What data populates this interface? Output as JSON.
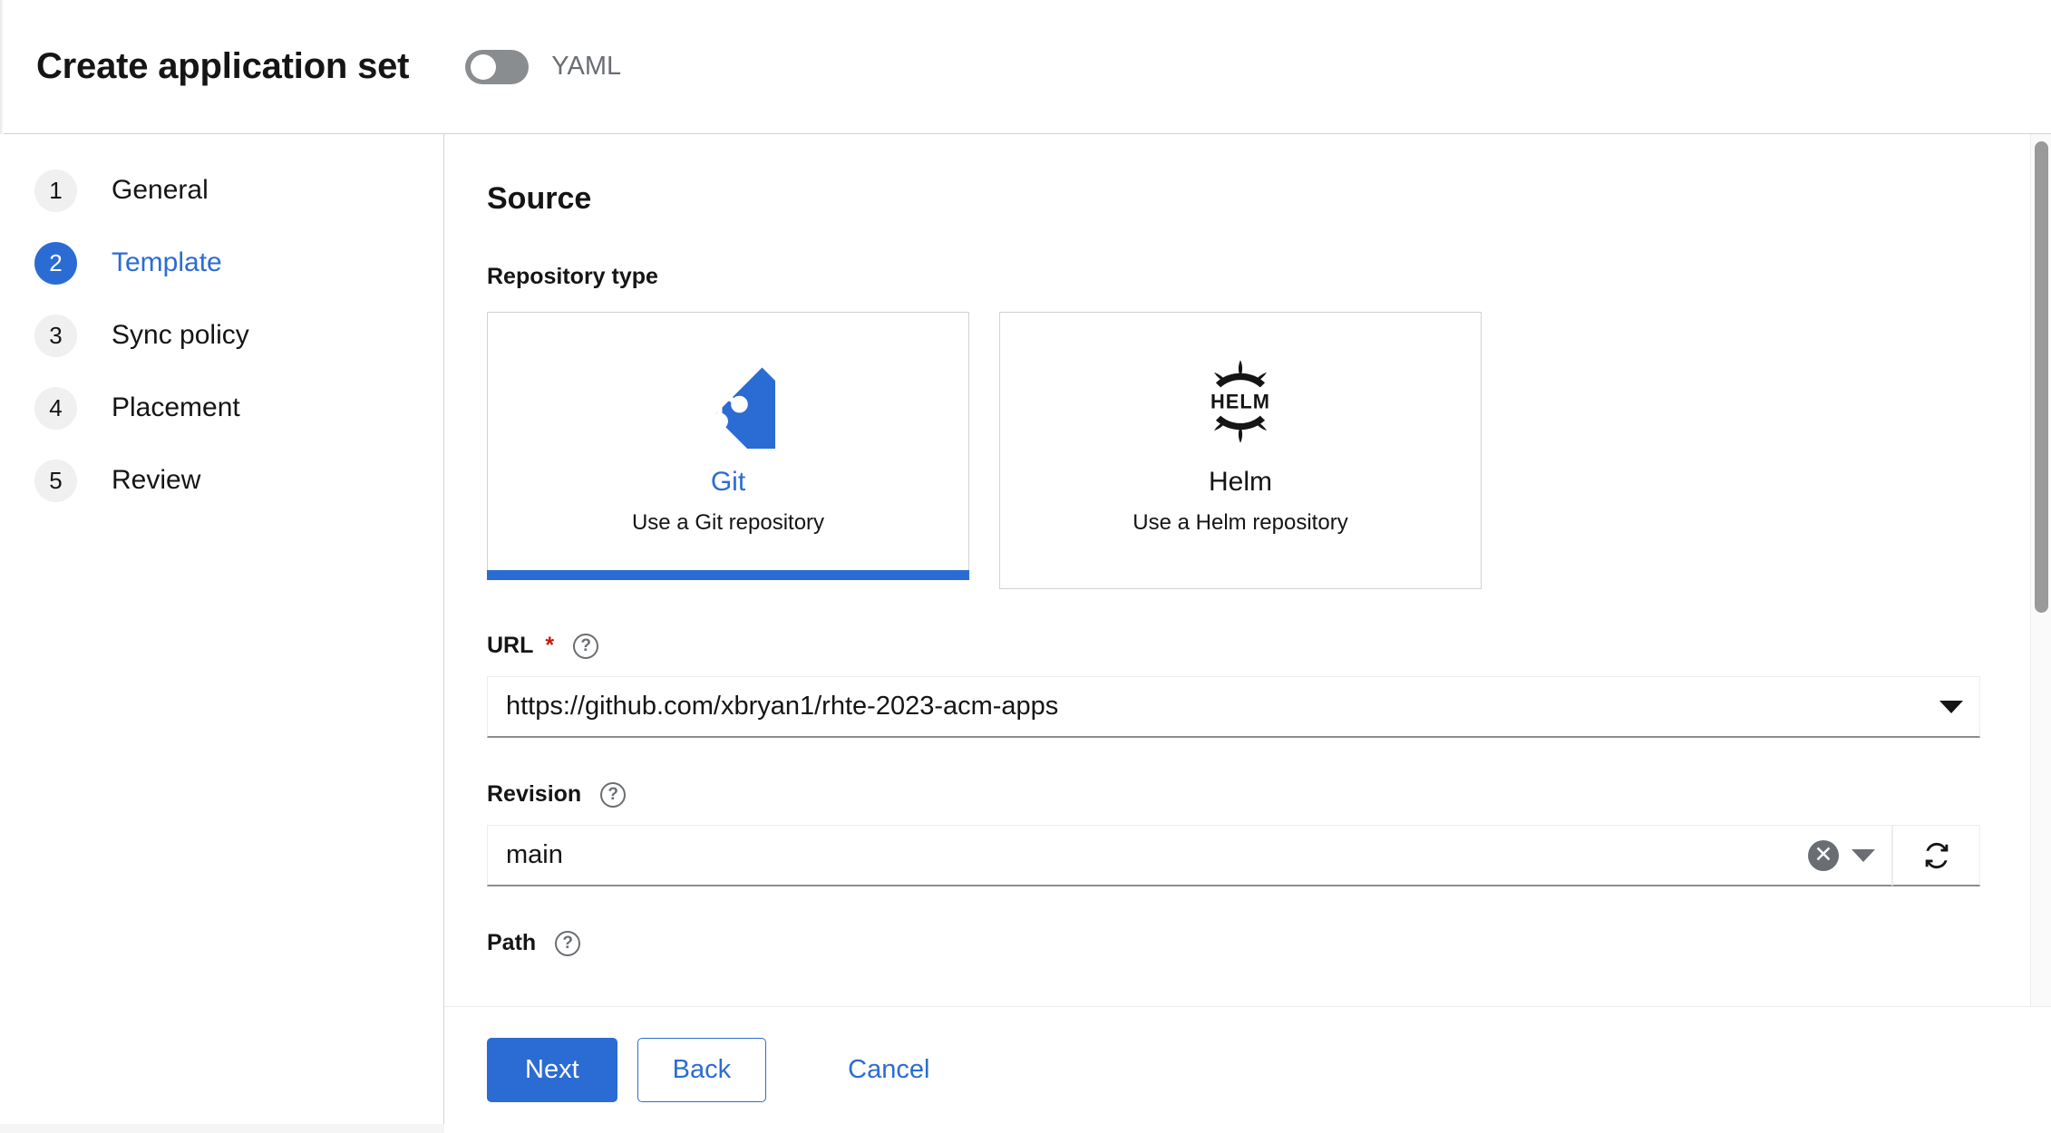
{
  "header": {
    "title": "Create application set",
    "yaml_toggle_label": "YAML",
    "yaml_toggle_state": "off"
  },
  "sidebar": {
    "steps": [
      {
        "number": "1",
        "label": "General",
        "active": false
      },
      {
        "number": "2",
        "label": "Template",
        "active": true
      },
      {
        "number": "3",
        "label": "Sync policy",
        "active": false
      },
      {
        "number": "4",
        "label": "Placement",
        "active": false
      },
      {
        "number": "5",
        "label": "Review",
        "active": false
      }
    ]
  },
  "main": {
    "section_title": "Source",
    "repository_type": {
      "label": "Repository type",
      "cards": [
        {
          "title": "Git",
          "description": "Use a Git repository",
          "icon": "git-logo-icon",
          "selected": true
        },
        {
          "title": "Helm",
          "description": "Use a Helm repository",
          "icon": "helm-logo-icon",
          "selected": false
        }
      ]
    },
    "url_field": {
      "label": "URL",
      "required_marker": "*",
      "help_icon": "question-circle-icon",
      "value": "https://github.com/xbryan1/rhte-2023-acm-apps",
      "dropdown_icon": "chevron-down-icon"
    },
    "revision_field": {
      "label": "Revision",
      "help_icon": "question-circle-icon",
      "value": "main",
      "clear_icon": "times-circle-icon",
      "dropdown_icon": "chevron-down-icon",
      "refresh_icon": "sync-refresh-icon"
    },
    "path_field": {
      "label": "Path",
      "help_icon": "question-circle-icon"
    }
  },
  "footer": {
    "next_label": "Next",
    "back_label": "Back",
    "cancel_label": "Cancel"
  },
  "colors": {
    "accent": "#2b6cd4",
    "required": "#c9190b",
    "muted": "#6a6e73",
    "border": "#d2d2d2"
  }
}
